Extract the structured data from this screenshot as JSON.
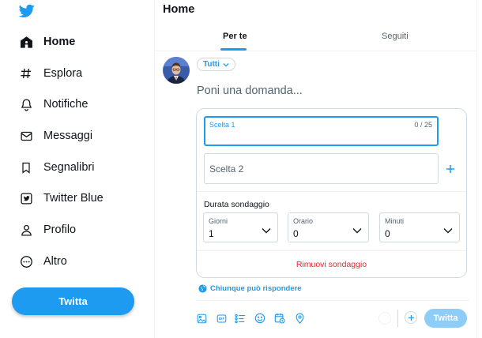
{
  "sidebar": {
    "logo_icon": "twitter-bird-icon",
    "items": [
      {
        "label": "Home",
        "icon": "home-icon"
      },
      {
        "label": "Esplora",
        "icon": "hashtag-icon"
      },
      {
        "label": "Notifiche",
        "icon": "bell-icon"
      },
      {
        "label": "Messaggi",
        "icon": "envelope-icon"
      },
      {
        "label": "Segnalibri",
        "icon": "bookmark-icon"
      },
      {
        "label": "Twitter Blue",
        "icon": "twitter-blue-icon"
      },
      {
        "label": "Profilo",
        "icon": "person-icon"
      },
      {
        "label": "Altro",
        "icon": "more-circle-icon"
      }
    ],
    "tweet_button": "Twitta"
  },
  "main": {
    "title": "Home",
    "tabs": [
      {
        "label": "Per te",
        "active": true
      },
      {
        "label": "Seguiti",
        "active": false
      }
    ]
  },
  "composer": {
    "audience": "Tutti",
    "placeholder": "Poni una domanda...",
    "poll": {
      "choice1_label": "Scelta 1",
      "choice1_count": "0 / 25",
      "choice2_placeholder": "Scelta 2",
      "duration_label": "Durata sondaggio",
      "selects": [
        {
          "title": "Giorni",
          "value": "1"
        },
        {
          "title": "Orario",
          "value": "0"
        },
        {
          "title": "Minuti",
          "value": "0"
        }
      ],
      "remove_label": "Rimuovi sondaggio"
    },
    "reply_setting": "Chiunque può rispondere",
    "toolbar_icons": [
      "image-icon",
      "gif-icon",
      "poll-icon",
      "emoji-icon",
      "schedule-icon",
      "location-icon"
    ],
    "submit_label": "Twitta"
  },
  "colors": {
    "accent": "#1d9bf0",
    "accent_disabled": "#8ecdf8",
    "danger": "#f4212e",
    "border": "#cfd9de",
    "text_secondary": "#536471"
  }
}
